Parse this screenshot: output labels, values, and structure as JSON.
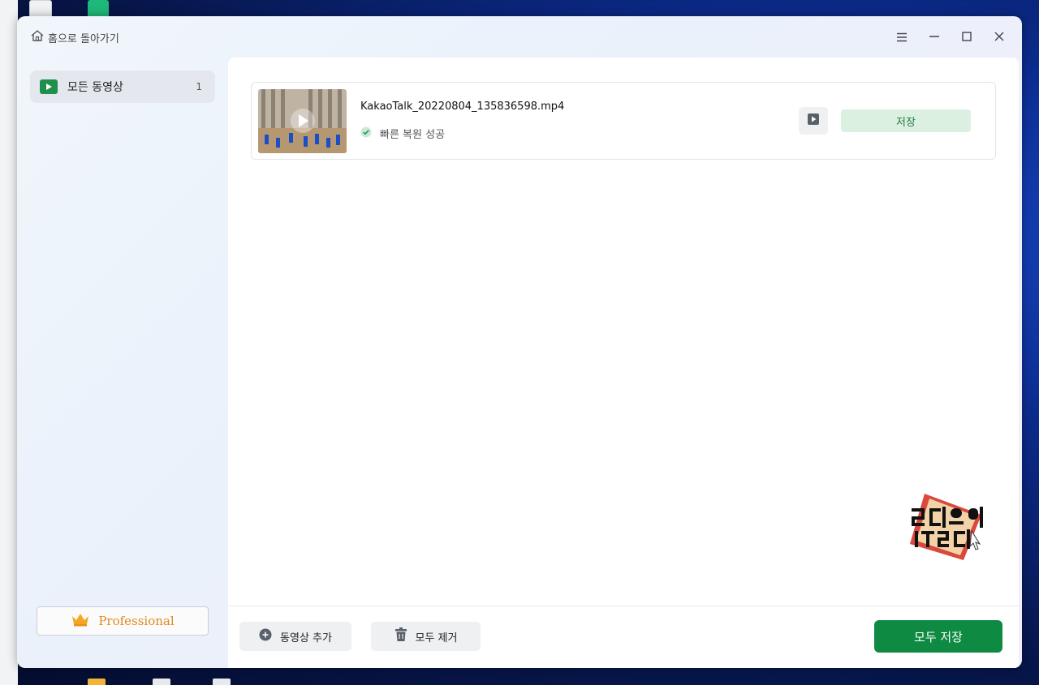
{
  "window": {
    "back_label": "홈으로 돌아가기"
  },
  "sidebar": {
    "items": [
      {
        "label": "모든 동영상",
        "count": "1",
        "icon": "play-icon"
      }
    ],
    "professional_label": "Professional"
  },
  "files": [
    {
      "name": "KakaoTalk_20220804_135836598.mp4",
      "status": "빠른 복원 성공",
      "save_label": "저장"
    }
  ],
  "footer": {
    "add_label": "동영상 추가",
    "remove_label": "모두 제거",
    "save_all_label": "모두 저장"
  },
  "colors": {
    "accent_green": "#0e8a43",
    "save_light_green": "#dcf0e2",
    "pro_orange": "#e08a1e"
  }
}
